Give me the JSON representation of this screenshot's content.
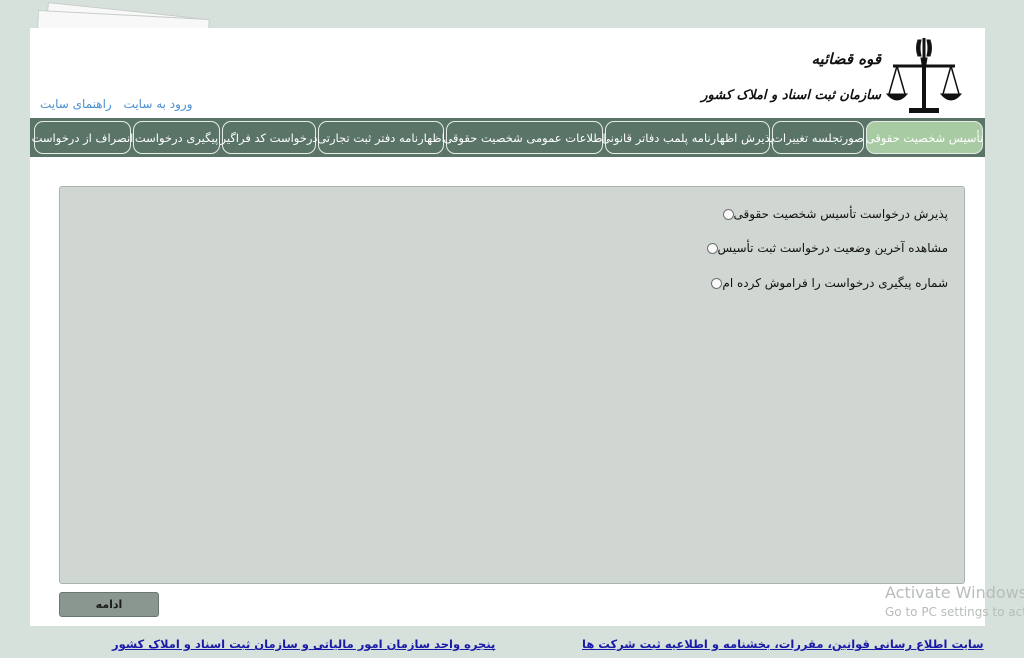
{
  "header": {
    "brand_top": "قوه قضائیه",
    "brand_main": "سازمان ثبت اسناد و املاک کشور",
    "links": [
      "ورود به سایت",
      "راهنمای سایت"
    ]
  },
  "tabs": [
    {
      "label": "تأسیس شخصیت حقوقی",
      "active": true
    },
    {
      "label": "صورتجلسه تغییرات",
      "active": false
    },
    {
      "label": "پذیرش اظهارنامه پلمب دفاتر قانونی",
      "active": false
    },
    {
      "label": "اطلاعات عمومی شخصیت حقوقی",
      "active": false
    },
    {
      "label": "اظهارنامه دفتر ثبت تجارتی",
      "active": false
    },
    {
      "label": "درخواست کد فراگیر",
      "active": false
    },
    {
      "label": "پیگیری درخواست",
      "active": false
    },
    {
      "label": "انصراف از درخواست",
      "active": false
    }
  ],
  "options": [
    {
      "label": "پذیرش درخواست تأسیس شخصیت حقوقی",
      "checked": false
    },
    {
      "label": "مشاهده آخرین وضعیت درخواست ثبت تأسیس",
      "checked": false
    },
    {
      "label": "شماره پیگیری درخواست را فراموش کرده ام",
      "checked": false
    }
  ],
  "continue_label": "ادامه",
  "footer": {
    "left_link": "پنجره واحد سازمان امور مالیاتی و سازمان ثبت اسناد و املاک کشور",
    "right_link": "سایت اطلاع رسانی قوانین، مقررات، بخشنامه و اطلاعیه ثبت شرکت ها"
  },
  "watermark": {
    "line1": "Activate Windows",
    "line2": "Go to PC settings to activate Windows."
  },
  "colors": {
    "page_bg": "#d7e1dc",
    "tab_bar": "#5a7567",
    "tab_active": "#a9cba4",
    "panel_bg": "#d0d6d2",
    "link": "#1a1aa8",
    "header_link": "#4a8fcf"
  }
}
